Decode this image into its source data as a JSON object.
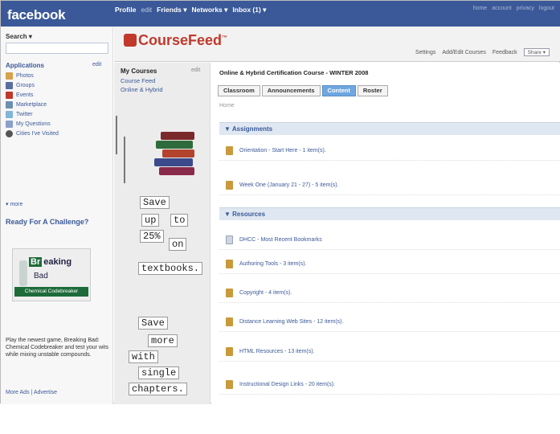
{
  "brand": {
    "facebook": "facebook",
    "coursefeed": "CourseFeed"
  },
  "topnav": {
    "profile": "Profile",
    "profile_edit": "edit",
    "friends": "Friends ▾",
    "networks": "Networks ▾",
    "inbox": "Inbox (1) ▾"
  },
  "toplinks": [
    "home",
    "account",
    "privacy",
    "logout"
  ],
  "leftbar": {
    "search_label": "Search ▾",
    "apps_title": "Applications",
    "apps_edit": "edit",
    "apps": [
      {
        "label": "Photos",
        "icon": "photos-icon",
        "color": "#d7a24a"
      },
      {
        "label": "Groups",
        "icon": "groups-icon",
        "color": "#5a6ea0"
      },
      {
        "label": "Events",
        "icon": "events-icon",
        "color": "#c0392b"
      },
      {
        "label": "Marketplace",
        "icon": "marketplace-icon",
        "color": "#6f8fb0"
      },
      {
        "label": "Twitter",
        "icon": "twitter-icon",
        "color": "#7fb6d9"
      },
      {
        "label": "My Questions",
        "icon": "questions-icon",
        "color": "#8aa0c8"
      },
      {
        "label": "Cities I've Visited",
        "icon": "cities-icon",
        "color": "#555555"
      }
    ],
    "more": "▾ more",
    "ad": {
      "title": "Ready For A Challenge?",
      "img_line1": "Br",
      "img_line1_rest": "eaking",
      "img_line2": "Bad",
      "img_bar": "Chemical Codebreaker",
      "body": "Play the newest game, Breaking Bad: Chemical Codebreaker and test your wits while mixing unstable compounds.",
      "links": "More Ads | Advertise"
    }
  },
  "app_header": {
    "settings": "Settings",
    "add_edit": "Add/Edit Courses",
    "feedback": "Feedback",
    "share": "Share ▾"
  },
  "coursebar": {
    "title": "My Courses",
    "edit": "edit",
    "items": [
      "Course Feed",
      "Online & Hybrid"
    ],
    "ad_words": [
      "Save",
      "up",
      "to",
      "25%",
      "on",
      "textbooks.",
      "Save",
      "more",
      "with",
      "single",
      "chapters."
    ]
  },
  "main": {
    "course_title": "Online & Hybrid Certification Course - WINTER 2008",
    "tabs": [
      "Classroom",
      "Announcements",
      "Content",
      "Roster"
    ],
    "active_tab": "Content",
    "home": "Home",
    "sections": [
      {
        "title": "▼ Assignments",
        "items": [
          {
            "label": "Orientation - Start Here - 1 item(s).",
            "icon": "folder-icon"
          },
          {
            "label": "Week One (January 21 - 27) - 5 item(s).",
            "icon": "folder-icon"
          }
        ]
      },
      {
        "title": "▼ Resources",
        "items": [
          {
            "label": "DHCC - Most Recent Bookmarks",
            "icon": "document-icon"
          },
          {
            "label": "Authoring Tools - 3 item(s).",
            "icon": "folder-icon"
          },
          {
            "label": "Copyright - 4 item(s).",
            "icon": "folder-icon"
          },
          {
            "label": "Distance Learning Web Sites - 12 item(s).",
            "icon": "folder-icon"
          },
          {
            "label": "HTML Resources - 13 item(s).",
            "icon": "folder-icon"
          },
          {
            "label": "Instructional Design Links - 20 item(s).",
            "icon": "folder-icon"
          }
        ]
      }
    ]
  },
  "colors": {
    "facebook_blue": "#3b5998",
    "coursefeed_red": "#c0392b",
    "active_tab": "#6ea7e0"
  }
}
